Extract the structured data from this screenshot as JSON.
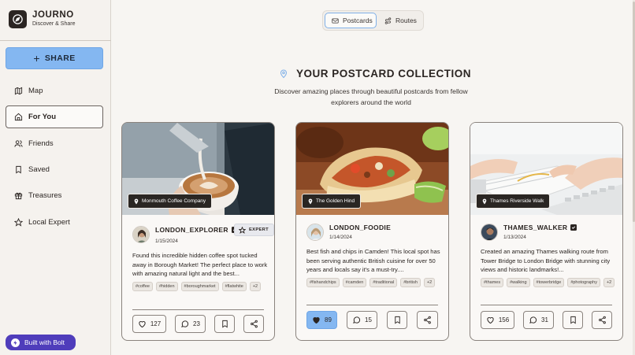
{
  "brand": {
    "name": "JOURNO",
    "tagline": "Discover & Share"
  },
  "sidebar": {
    "share_label": "SHARE",
    "items": [
      {
        "label": "Map",
        "icon": "map-icon",
        "active": false
      },
      {
        "label": "For You",
        "icon": "home-icon",
        "active": true
      },
      {
        "label": "Friends",
        "icon": "users-icon",
        "active": false
      },
      {
        "label": "Saved",
        "icon": "bookmark-icon",
        "active": false
      },
      {
        "label": "Treasures",
        "icon": "gift-icon",
        "active": false
      },
      {
        "label": "Local Expert",
        "icon": "star-icon",
        "active": false
      }
    ]
  },
  "bolt_badge": "Built with Bolt",
  "view_toggle": {
    "postcards": "Postcards",
    "routes": "Routes",
    "selected": "Postcards"
  },
  "collection": {
    "title": "YOUR POSTCARD COLLECTION",
    "subtitle": "Discover amazing places through beautiful postcards from fellow explorers around the world"
  },
  "postcards": [
    {
      "location": "Monmouth Coffee Company",
      "username": "LONDON_EXPLORER",
      "verified": true,
      "expert_label": "EXPERT",
      "date": "1/15/2024",
      "text": "Found this incredible hidden coffee spot tucked away in Borough Market! The perfect place to work with amazing natural light and the best...",
      "tags": [
        "#coffee",
        "#hidden",
        "#boroughmarket",
        "#flatwhite"
      ],
      "more_tags": "+2",
      "likes": "127",
      "liked": false,
      "comments": "23"
    },
    {
      "location": "The Golden Hind",
      "username": "LONDON_FOODIE",
      "verified": false,
      "date": "1/14/2024",
      "text": "Best fish and chips in Camden! This local spot has been serving authentic British cuisine for over 50 years and locals say it's a must-try....",
      "tags": [
        "#fishandchips",
        "#camden",
        "#traditional",
        "#british"
      ],
      "more_tags": "+2",
      "likes": "89",
      "liked": true,
      "comments": "15"
    },
    {
      "location": "Thames Riverside Walk",
      "username": "THAMES_WALKER",
      "verified": true,
      "date": "1/13/2024",
      "text": "Created an amazing Thames walking route from Tower Bridge to London Bridge with stunning city views and historic landmarks!...",
      "tags": [
        "#thames",
        "#walking",
        "#towerbridge",
        "#photography"
      ],
      "more_tags": "+2",
      "likes": "156",
      "liked": false,
      "comments": "31"
    }
  ],
  "colors": {
    "accent": "#84b7f1",
    "dark": "#2b2522",
    "bolt": "#4f3dbb"
  }
}
